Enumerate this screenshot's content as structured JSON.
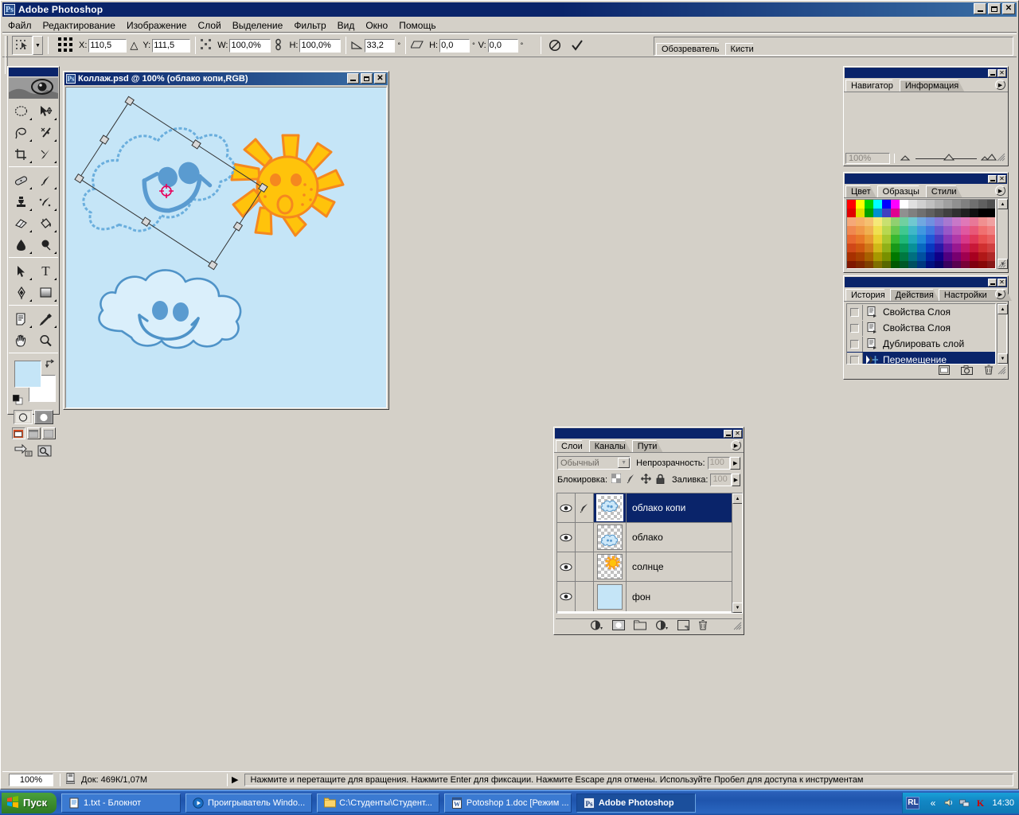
{
  "app": {
    "title": "Adobe Photoshop",
    "window_buttons": [
      "minimize",
      "maximize",
      "close"
    ]
  },
  "menubar": {
    "items": [
      {
        "label": "Файл"
      },
      {
        "label": "Редактирование"
      },
      {
        "label": "Изображение"
      },
      {
        "label": "Слой"
      },
      {
        "label": "Выделение"
      },
      {
        "label": "Фильтр"
      },
      {
        "label": "Вид"
      },
      {
        "label": "Окно"
      },
      {
        "label": "Помощь"
      }
    ]
  },
  "options_bar": {
    "tool_icon": "move-tool-marquee-icon",
    "reference_point_label": "reference-point-grid",
    "x_label": "X:",
    "x_value": "110,5",
    "delta_symbol": "△",
    "y_label": "Y:",
    "y_value": "111,5",
    "w_label": "W:",
    "w_value": "100,0%",
    "link_icon": "chain-link-icon",
    "h_label": "H:",
    "h_value": "100,0%",
    "angle_label": "∠",
    "angle_value": "33,2",
    "angle_unit": "°",
    "skew_icon": "skew-icon",
    "skew_h_label": "H:",
    "skew_h_value": "0,0",
    "skew_h_unit": "°",
    "skew_v_label": "V:",
    "skew_v_value": "0,0",
    "skew_v_unit": "°",
    "cancel_icon": "cancel-transform-icon",
    "commit_icon": "commit-transform-checkmark-icon",
    "palette_well_tabs": [
      "Обозреватель",
      "Кисти"
    ]
  },
  "toolbox": {
    "tools": [
      {
        "name": "elliptical-marquee-tool",
        "glyph": "○"
      },
      {
        "name": "move-tool",
        "glyph": "➤"
      },
      {
        "name": "lasso-tool",
        "glyph": "ϟ"
      },
      {
        "name": "magic-wand-tool",
        "glyph": "✳"
      },
      {
        "name": "crop-tool",
        "glyph": "⌗"
      },
      {
        "name": "slice-tool",
        "glyph": "✂"
      },
      {
        "name": "healing-brush-tool",
        "glyph": "▰"
      },
      {
        "name": "brush-tool",
        "glyph": "✎"
      },
      {
        "name": "clone-stamp-tool",
        "glyph": "♙"
      },
      {
        "name": "history-brush-tool",
        "glyph": "✐"
      },
      {
        "name": "eraser-tool",
        "glyph": "▱"
      },
      {
        "name": "paint-bucket-tool",
        "glyph": "⬟"
      },
      {
        "name": "blur-tool",
        "glyph": "💧"
      },
      {
        "name": "dodge-tool",
        "glyph": "●"
      },
      {
        "name": "path-selection-tool",
        "glyph": "➤"
      },
      {
        "name": "type-tool",
        "glyph": "T"
      },
      {
        "name": "pen-tool",
        "glyph": "✒"
      },
      {
        "name": "rectangle-shape-tool",
        "glyph": "▣"
      },
      {
        "name": "notes-tool",
        "glyph": "▤"
      },
      {
        "name": "eyedropper-tool",
        "glyph": "⚲"
      },
      {
        "name": "hand-tool",
        "glyph": "✋"
      },
      {
        "name": "zoom-tool",
        "glyph": "🔍"
      }
    ],
    "foreground_color": "#c5e5f7",
    "background_color": "#ffffff",
    "mask_modes": [
      "standard-mask-mode",
      "quick-mask-mode"
    ],
    "screen_modes": [
      "standard-screen-mode",
      "full-screen-with-menubar",
      "full-screen-mode"
    ],
    "jump_to": [
      "jump-to-imageready-icon",
      "jump-to-preview-icon"
    ]
  },
  "document": {
    "title": "Коллаж.psd @ 100% (облако копи,RGB)",
    "zoom": "100%",
    "canvas_bg": "#c5e5f7",
    "artwork": {
      "sun_fill": "#ffc30b",
      "sun_stroke": "#f5881f",
      "cloud_stroke": "#4f93c8",
      "cloud_fill": "#daeffb",
      "eye_color": "#5a9bd0",
      "transform_angle": 33.2
    },
    "window_buttons": [
      "minimize",
      "maximize",
      "close"
    ]
  },
  "navigator_palette": {
    "tabs": [
      "Навигатор",
      "Информация"
    ],
    "active_tab": "Навигатор",
    "zoom_value": "100%",
    "view_box_color": "#ff0000"
  },
  "color_palette": {
    "tabs": [
      "Цвет",
      "Образцы",
      "Стили"
    ],
    "active_tab": "Образцы",
    "swatch_rows": [
      [
        "#ff0000",
        "#ffff00",
        "#00d000",
        "#00ffff",
        "#0000ff",
        "#ff00ff",
        "#ffffff",
        "#e0e0e0",
        "#d0d0d0",
        "#c0c0c0",
        "#b0b0b0",
        "#a0a0a0",
        "#909090",
        "#808080",
        "#707070",
        "#606060",
        "#505050",
        "#404040"
      ],
      [
        "#e00000",
        "#e0e000",
        "#00a000",
        "#0090d0",
        "#4040c0",
        "#e00090",
        "#909090",
        "#808080",
        "#707070",
        "#606060",
        "#505050",
        "#404040",
        "#303030",
        "#202020",
        "#101010",
        "#000000",
        "#000000",
        "#000000"
      ],
      [
        "#f5a878",
        "#f5b068",
        "#f5c070",
        "#f5e878",
        "#c8e070",
        "#90d070",
        "#70d0a0",
        "#70c8d0",
        "#70a8e0",
        "#7090e0",
        "#8878d8",
        "#a878d0",
        "#c878c8",
        "#e078b8",
        "#e87898",
        "#f09090",
        "#f0a0a0",
        "#f0b0b0"
      ],
      [
        "#f08850",
        "#f09848",
        "#f0b050",
        "#f0e050",
        "#b8d850",
        "#68c850",
        "#40c890",
        "#40b8c8",
        "#4098e0",
        "#4078e0",
        "#6858d0",
        "#9858c8",
        "#c058b8",
        "#e058a0",
        "#e85878",
        "#f07070",
        "#f08080",
        "#f09090"
      ],
      [
        "#e86830",
        "#e87828",
        "#e89830",
        "#e8d030",
        "#a8c830",
        "#38b830",
        "#20b878",
        "#20a8b8",
        "#2088d8",
        "#2058d8",
        "#4838c0",
        "#8838b8",
        "#b038a8",
        "#d83888",
        "#e03858",
        "#e85050",
        "#e86060",
        "#e87070"
      ],
      [
        "#d04818",
        "#d05810",
        "#d07818",
        "#d0b818",
        "#90b018",
        "#189818",
        "#089858",
        "#089098",
        "#0868c0",
        "#0838c0",
        "#2818a8",
        "#6818a0",
        "#981890",
        "#c01868",
        "#c81838",
        "#d03030",
        "#d04040",
        "#d05050"
      ],
      [
        "#a83000",
        "#a84000",
        "#a86000",
        "#a89800",
        "#789000",
        "#007800",
        "#007840",
        "#007080",
        "#0050a0",
        "#0020a0",
        "#100088",
        "#500080",
        "#780070",
        "#a00050",
        "#a80020",
        "#b01818",
        "#b02828",
        "#b03838"
      ],
      [
        "#801800",
        "#802800",
        "#804000",
        "#807000",
        "#586800",
        "#005800",
        "#005828",
        "#005060",
        "#003880",
        "#001080",
        "#080068",
        "#380060",
        "#580050",
        "#780038",
        "#800010",
        "#880808",
        "#881818",
        "#882828"
      ],
      [
        "#c8b8a8",
        "#a89080",
        "#907868",
        "#706050",
        "#504038",
        "#d8a868",
        "#c89058",
        "#b87848",
        "#a86038",
        "#e8e4dc",
        "#e8e4dc",
        "#e8e4dc",
        "#e8e4dc",
        "#e8e4dc",
        "#e8e4dc",
        "#e8e4dc",
        "#e8e4dc",
        "#e8e4dc"
      ]
    ]
  },
  "history_palette": {
    "tabs": [
      "История",
      "Действия",
      "Настройки инструментов"
    ],
    "active_tab": "История",
    "entries": [
      {
        "label": "Свойства Слоя",
        "icon": "layer-properties-icon",
        "selected": false
      },
      {
        "label": "Свойства Слоя",
        "icon": "layer-properties-icon",
        "selected": false
      },
      {
        "label": "Дублировать слой",
        "icon": "duplicate-layer-icon",
        "selected": false
      },
      {
        "label": "Перемещение",
        "icon": "move-icon",
        "selected": true
      }
    ],
    "footer_buttons": [
      "new-document-from-state-icon",
      "new-snapshot-icon",
      "delete-state-icon"
    ]
  },
  "layers_palette": {
    "tabs": [
      "Слои",
      "Каналы",
      "Пути"
    ],
    "active_tab": "Слои",
    "blend_mode": "Обычный",
    "opacity_label": "Непрозрачность:",
    "opacity_value": "100",
    "lock_label": "Блокировка:",
    "lock_icons": [
      "lock-transparency-icon",
      "lock-image-icon",
      "lock-position-icon",
      "lock-all-icon"
    ],
    "fill_label": "Заливка:",
    "fill_value": "100",
    "layers": [
      {
        "name": "облако копи",
        "visible": true,
        "linked": false,
        "active": true,
        "thumb": "cloud-transparent"
      },
      {
        "name": "облако",
        "visible": true,
        "linked": false,
        "active": false,
        "thumb": "cloud-transparent"
      },
      {
        "name": "солнце",
        "visible": true,
        "linked": false,
        "active": false,
        "thumb": "sun-transparent"
      },
      {
        "name": "фон",
        "visible": true,
        "linked": false,
        "active": false,
        "thumb": "solid-blue"
      }
    ],
    "footer_buttons": [
      "layer-style-icon",
      "layer-mask-icon",
      "new-group-icon",
      "adjustment-layer-icon",
      "new-layer-icon",
      "delete-layer-icon"
    ]
  },
  "statusbar": {
    "zoom": "100%",
    "doc_size": "Док: 469К/1,07М",
    "hint": "Нажмите и перетащите для вращения. Нажмите Enter для фиксации. Нажмите Escape для отмены. Используйте Пробел для доступа к инструментам"
  },
  "taskbar": {
    "start_label": "Пуск",
    "buttons": [
      {
        "label": "1.txt - Блокнот",
        "icon": "notepad-icon",
        "active": false
      },
      {
        "label": "Проигрыватель Windo...",
        "icon": "media-player-icon",
        "active": false
      },
      {
        "label": "C:\\Студенты\\Студент...",
        "icon": "folder-icon",
        "active": false
      },
      {
        "label": "Potoshop 1.doc [Режим ...",
        "icon": "word-icon",
        "active": false
      },
      {
        "label": "Adobe Photoshop",
        "icon": "photoshop-icon",
        "active": true
      }
    ],
    "language": "RL",
    "tray_icons": [
      "chevron-left-icon",
      "volume-icon",
      "network-icon",
      "antivirus-icon"
    ],
    "clock": "14:30"
  }
}
